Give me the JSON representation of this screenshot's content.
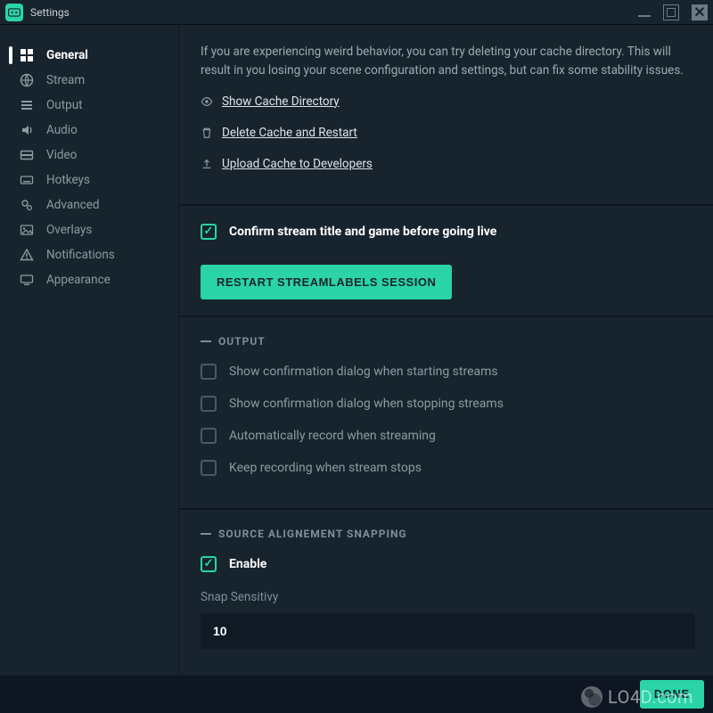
{
  "window": {
    "title": "Settings"
  },
  "sidebar": {
    "items": [
      {
        "label": "General"
      },
      {
        "label": "Stream"
      },
      {
        "label": "Output"
      },
      {
        "label": "Audio"
      },
      {
        "label": "Video"
      },
      {
        "label": "Hotkeys"
      },
      {
        "label": "Advanced"
      },
      {
        "label": "Overlays"
      },
      {
        "label": "Notifications"
      },
      {
        "label": "Appearance"
      }
    ]
  },
  "cache": {
    "info": "If you are experiencing weird behavior, you can try deleting your cache directory. This will result in you losing your scene configuration and settings, but can fix some stability issues.",
    "show_link": "Show Cache Directory",
    "delete_link": "Delete Cache and Restart",
    "upload_link": "Upload Cache to Developers"
  },
  "confirm_before_live": {
    "label": "Confirm stream title and game before going live",
    "checked": true
  },
  "restart_button": "RESTART STREAMLABELS SESSION",
  "output": {
    "heading": "OUTPUT",
    "options": [
      {
        "label": "Show confirmation dialog when starting streams",
        "checked": false
      },
      {
        "label": "Show confirmation dialog when stopping streams",
        "checked": false
      },
      {
        "label": "Automatically record when streaming",
        "checked": false
      },
      {
        "label": "Keep recording when stream stops",
        "checked": false
      }
    ]
  },
  "snapping": {
    "heading": "SOURCE ALIGNEMENT SNAPPING",
    "enable_label": "Enable",
    "enable_checked": true,
    "sensitivity_label": "Snap Sensitivy",
    "sensitivity_value": "10"
  },
  "footer": {
    "done": "DONE"
  },
  "watermark": "LO4D.com",
  "colors": {
    "accent": "#2ad4a7",
    "panel": "#17242d",
    "bg": "#0d1622"
  }
}
